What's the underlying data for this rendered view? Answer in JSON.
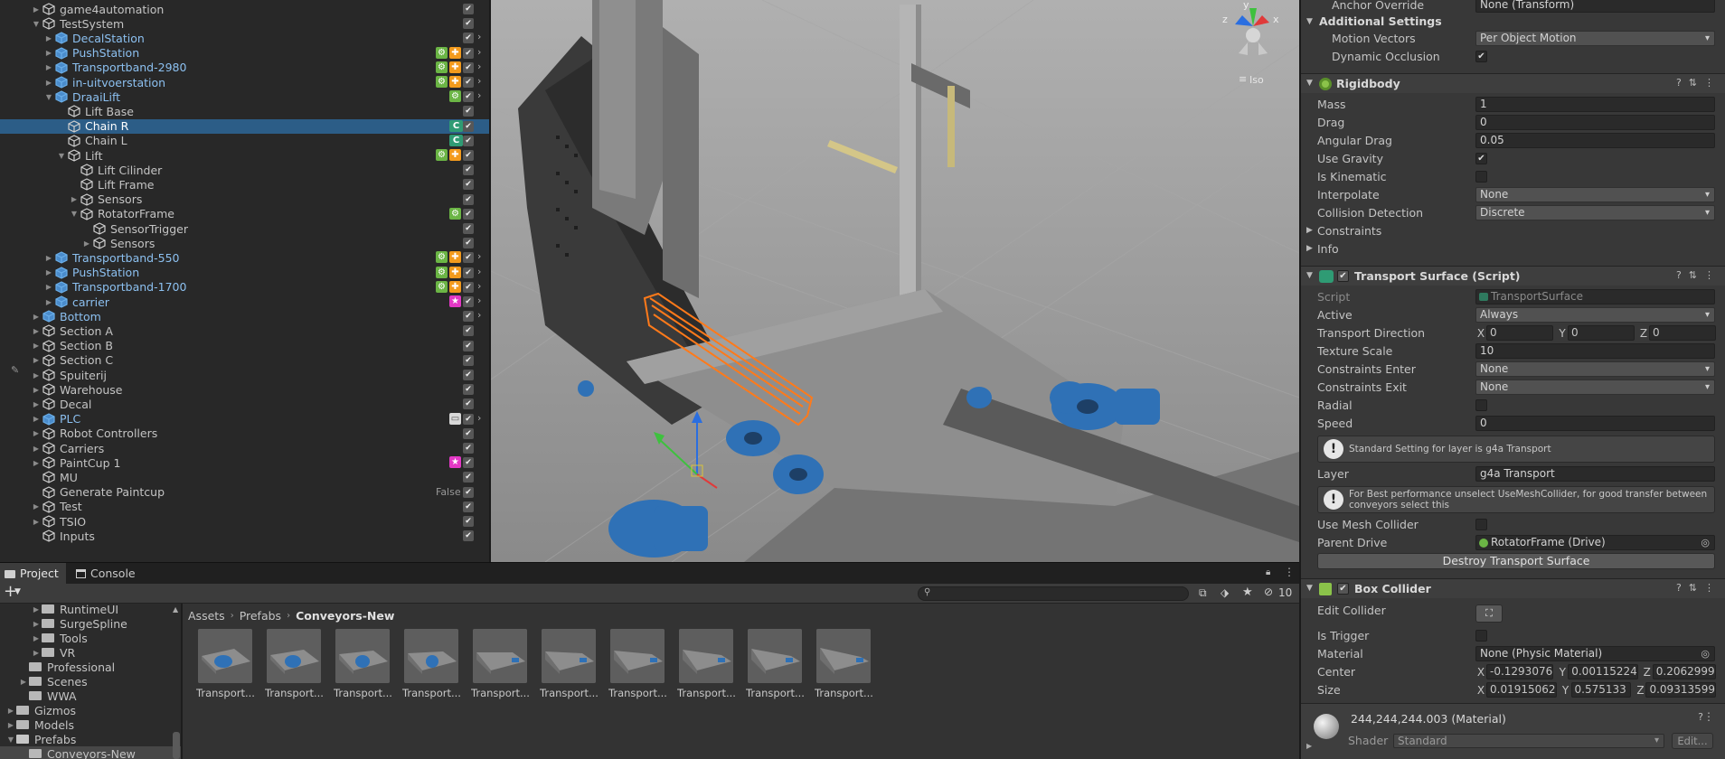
{
  "hierarchy": {
    "rows": [
      {
        "name": "game4automation",
        "indent": 1,
        "fold": "closed",
        "type": "gray",
        "icons": [],
        "vis": true,
        "arrow": false
      },
      {
        "name": "TestSystem",
        "indent": 1,
        "fold": "open",
        "type": "gray",
        "icons": [],
        "vis": true,
        "arrow": false
      },
      {
        "name": "DecalStation",
        "indent": 2,
        "fold": "closed",
        "type": "prefab",
        "icons": [],
        "vis": true,
        "arrow": true
      },
      {
        "name": "PushStation",
        "indent": 2,
        "fold": "closed",
        "type": "prefab",
        "icons": [
          "g",
          "o"
        ],
        "vis": true,
        "arrow": true
      },
      {
        "name": "Transportband-2980",
        "indent": 2,
        "fold": "closed",
        "type": "prefab",
        "icons": [
          "g",
          "o"
        ],
        "vis": true,
        "arrow": true
      },
      {
        "name": "in-uitvoerstation",
        "indent": 2,
        "fold": "closed",
        "type": "prefab",
        "icons": [
          "g",
          "o"
        ],
        "vis": true,
        "arrow": true
      },
      {
        "name": "DraaiLift",
        "indent": 2,
        "fold": "open",
        "type": "prefab",
        "icons": [
          "g"
        ],
        "vis": true,
        "arrow": true
      },
      {
        "name": "Lift Base",
        "indent": 3,
        "fold": "none",
        "type": "gray",
        "icons": [],
        "vis": true,
        "arrow": false
      },
      {
        "name": "Chain R",
        "indent": 3,
        "fold": "none",
        "type": "gray",
        "icons": [
          "s"
        ],
        "vis": true,
        "arrow": false,
        "selected": true
      },
      {
        "name": "Chain L",
        "indent": 3,
        "fold": "none",
        "type": "gray",
        "icons": [
          "s"
        ],
        "vis": true,
        "arrow": false
      },
      {
        "name": "Lift",
        "indent": 3,
        "fold": "open",
        "type": "gray",
        "icons": [
          "g",
          "o"
        ],
        "vis": true,
        "arrow": false
      },
      {
        "name": "Lift Cilinder",
        "indent": 4,
        "fold": "none",
        "type": "gray",
        "icons": [],
        "vis": true,
        "arrow": false
      },
      {
        "name": "Lift Frame",
        "indent": 4,
        "fold": "none",
        "type": "gray",
        "icons": [],
        "vis": true,
        "arrow": false
      },
      {
        "name": "Sensors",
        "indent": 4,
        "fold": "closed",
        "type": "gray",
        "icons": [],
        "vis": true,
        "arrow": false
      },
      {
        "name": "RotatorFrame",
        "indent": 4,
        "fold": "open",
        "type": "gray",
        "icons": [
          "g"
        ],
        "vis": true,
        "arrow": false
      },
      {
        "name": "SensorTrigger",
        "indent": 5,
        "fold": "none",
        "type": "gray",
        "icons": [],
        "vis": true,
        "arrow": false
      },
      {
        "name": "Sensors",
        "indent": 5,
        "fold": "closed",
        "type": "gray",
        "icons": [],
        "vis": true,
        "arrow": false
      },
      {
        "name": "Transportband-550",
        "indent": 2,
        "fold": "closed",
        "type": "prefab",
        "icons": [
          "g",
          "o"
        ],
        "vis": true,
        "arrow": true
      },
      {
        "name": "PushStation",
        "indent": 2,
        "fold": "closed",
        "type": "prefab",
        "icons": [
          "g",
          "o"
        ],
        "vis": true,
        "arrow": true
      },
      {
        "name": "Transportband-1700",
        "indent": 2,
        "fold": "closed",
        "type": "prefab",
        "icons": [
          "g",
          "o"
        ],
        "vis": true,
        "arrow": true
      },
      {
        "name": "carrier",
        "indent": 2,
        "fold": "closed",
        "type": "prefab",
        "icons": [
          "p"
        ],
        "vis": true,
        "arrow": true
      },
      {
        "name": "Bottom",
        "indent": 1,
        "fold": "closed",
        "type": "prefab",
        "icons": [],
        "vis": true,
        "arrow": true
      },
      {
        "name": "Section A",
        "indent": 1,
        "fold": "closed",
        "type": "gray",
        "icons": [],
        "vis": true,
        "arrow": false
      },
      {
        "name": "Section B",
        "indent": 1,
        "fold": "closed",
        "type": "gray",
        "icons": [],
        "vis": true,
        "arrow": false
      },
      {
        "name": "Section C",
        "indent": 1,
        "fold": "closed",
        "type": "gray",
        "icons": [],
        "vis": true,
        "arrow": false
      },
      {
        "name": "Spuiterij",
        "indent": 1,
        "fold": "closed",
        "type": "gray",
        "icons": [],
        "vis": true,
        "arrow": false
      },
      {
        "name": "Warehouse",
        "indent": 1,
        "fold": "closed",
        "type": "gray",
        "icons": [],
        "vis": true,
        "arrow": false
      },
      {
        "name": "Decal",
        "indent": 1,
        "fold": "closed",
        "type": "gray",
        "icons": [],
        "vis": true,
        "arrow": false
      },
      {
        "name": "PLC",
        "indent": 1,
        "fold": "closed",
        "type": "prefab",
        "icons": [
          "w"
        ],
        "vis": true,
        "arrow": true
      },
      {
        "name": "Robot Controllers",
        "indent": 1,
        "fold": "closed",
        "type": "gray",
        "icons": [],
        "vis": true,
        "arrow": false
      },
      {
        "name": "Carriers",
        "indent": 1,
        "fold": "closed",
        "type": "gray",
        "icons": [],
        "vis": true,
        "arrow": false
      },
      {
        "name": "PaintCup 1",
        "indent": 1,
        "fold": "closed",
        "type": "gray",
        "icons": [
          "p"
        ],
        "vis": true,
        "arrow": false
      },
      {
        "name": "MU",
        "indent": 1,
        "fold": "none",
        "type": "gray",
        "icons": [],
        "vis": true,
        "arrow": false
      },
      {
        "name": "Generate Paintcup",
        "indent": 1,
        "fold": "none",
        "type": "gray",
        "icons": [],
        "flag": "False",
        "vis": true,
        "arrow": false
      },
      {
        "name": "Test",
        "indent": 1,
        "fold": "closed",
        "type": "gray",
        "icons": [],
        "vis": true,
        "arrow": false
      },
      {
        "name": "TSIO",
        "indent": 1,
        "fold": "closed",
        "type": "gray",
        "icons": [],
        "vis": true,
        "arrow": false
      },
      {
        "name": "Inputs",
        "indent": 1,
        "fold": "none",
        "type": "gray",
        "icons": [],
        "vis": true,
        "arrow": false
      }
    ]
  },
  "scene": {
    "gizmo_label": "Iso",
    "axis_x": "x",
    "axis_y": "y",
    "axis_z": "z"
  },
  "bottom_tabs": {
    "project": "Project",
    "console": "Console"
  },
  "project": {
    "add_label": "+",
    "hidden_count": "10",
    "breadcrumb": [
      "Assets",
      "Prefabs",
      "Conveyors-New"
    ],
    "tree": [
      {
        "name": "RuntimeUI",
        "indent": 3,
        "fold": "closed"
      },
      {
        "name": "SurgeSpline",
        "indent": 3,
        "fold": "closed"
      },
      {
        "name": "Tools",
        "indent": 3,
        "fold": "closed"
      },
      {
        "name": "VR",
        "indent": 3,
        "fold": "closed"
      },
      {
        "name": "Professional",
        "indent": 2,
        "fold": "none"
      },
      {
        "name": "Scenes",
        "indent": 2,
        "fold": "closed"
      },
      {
        "name": "WWA",
        "indent": 2,
        "fold": "none"
      },
      {
        "name": "Gizmos",
        "indent": 1,
        "fold": "closed"
      },
      {
        "name": "Models",
        "indent": 1,
        "fold": "closed"
      },
      {
        "name": "Prefabs",
        "indent": 1,
        "fold": "open"
      },
      {
        "name": "Conveyors-New",
        "indent": 2,
        "fold": "none",
        "selected": true
      }
    ],
    "assets": [
      "Transport...",
      "Transport...",
      "Transport...",
      "Transport...",
      "Transport...",
      "Transport...",
      "Transport...",
      "Transport...",
      "Transport...",
      "Transport..."
    ]
  },
  "inspector": {
    "anchor_override": {
      "label": "Anchor Override",
      "value": "None (Transform)"
    },
    "additional_settings": "Additional Settings",
    "motion_vectors": {
      "label": "Motion Vectors",
      "value": "Per Object Motion"
    },
    "dynamic_occlusion": {
      "label": "Dynamic Occlusion",
      "check": "✔"
    },
    "rigidbody": {
      "title": "Rigidbody",
      "mass": {
        "label": "Mass",
        "value": "1"
      },
      "drag": {
        "label": "Drag",
        "value": "0"
      },
      "angular_drag": {
        "label": "Angular Drag",
        "value": "0.05"
      },
      "use_gravity": {
        "label": "Use Gravity",
        "check": "✔"
      },
      "is_kinematic": {
        "label": "Is Kinematic",
        "check": ""
      },
      "interpolate": {
        "label": "Interpolate",
        "value": "None"
      },
      "collision_detection": {
        "label": "Collision Detection",
        "value": "Discrete"
      },
      "constraints": "Constraints",
      "info": "Info"
    },
    "transport_surface": {
      "title": "Transport Surface (Script)",
      "script": {
        "label": "Script",
        "value": "TransportSurface"
      },
      "active": {
        "label": "Active",
        "value": "Always"
      },
      "direction": {
        "label": "Transport Direction",
        "x": "0",
        "y": "0",
        "z": "0"
      },
      "texture_scale": {
        "label": "Texture Scale",
        "value": "10"
      },
      "constraints_enter": {
        "label": "Constraints Enter",
        "value": "None"
      },
      "constraints_exit": {
        "label": "Constraints Exit",
        "value": "None"
      },
      "radial": {
        "label": "Radial",
        "check": ""
      },
      "speed": {
        "label": "Speed",
        "value": "0"
      },
      "help1": "Standard Setting for layer is g4a Transport",
      "layer": {
        "label": "Layer",
        "value": "g4a Transport"
      },
      "help2": "For Best performance unselect UseMeshCollider, for good transfer between conveyors select this",
      "use_mesh_collider": {
        "label": "Use Mesh Collider",
        "check": ""
      },
      "parent_drive": {
        "label": "Parent Drive",
        "value": "RotatorFrame (Drive)"
      },
      "destroy_button": "Destroy Transport Surface"
    },
    "box_collider": {
      "title": "Box Collider",
      "edit_collider": "Edit Collider",
      "is_trigger": {
        "label": "Is Trigger",
        "check": ""
      },
      "material": {
        "label": "Material",
        "value": "None (Physic Material)"
      },
      "center": {
        "label": "Center",
        "x": "-0.1293076",
        "y": "0.00115224",
        "z": "0.2062999"
      },
      "size": {
        "label": "Size",
        "x": "0.01915062",
        "y": "0.575133",
        "z": "0.09313599"
      }
    },
    "material": {
      "title": "244,244,244.003 (Material)",
      "shader_label": "Shader",
      "shader_value": "Standard",
      "edit_label": "Edit..."
    }
  },
  "colors": {
    "accent_blue": "#2c5d87",
    "prefab_text": "#8cc0f0",
    "selection_orange": "#ff7a1a"
  }
}
